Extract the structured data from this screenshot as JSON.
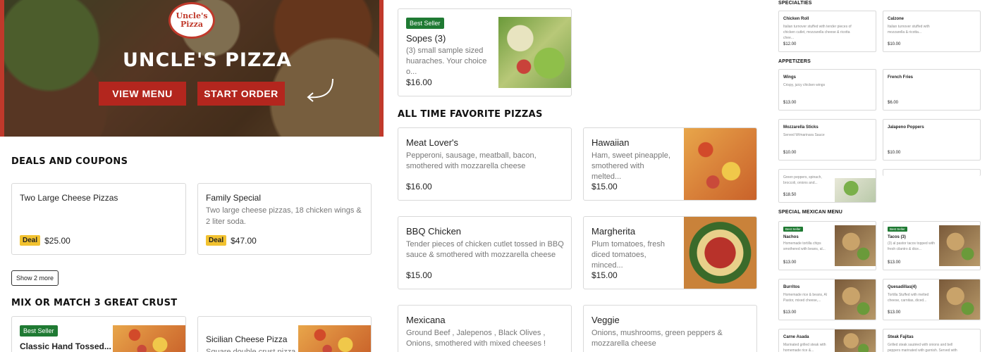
{
  "hero": {
    "logo_line1": "Uncle's",
    "logo_line2": "Pizza",
    "title": "UNCLE'S PIZZA",
    "view_menu": "VIEW MENU",
    "start_order": "START ORDER"
  },
  "deals": {
    "heading": "DEALS AND COUPONS",
    "items": [
      {
        "title": "Two Large Cheese Pizzas",
        "desc": "",
        "badge": "Deal",
        "price": "$25.00"
      },
      {
        "title": "Family Special",
        "desc": "Two large cheese pizzas, 18 chicken wings & 2 liter soda.",
        "badge": "Deal",
        "price": "$47.00"
      }
    ],
    "show_more": "Show 2 more"
  },
  "mix": {
    "heading": "MIX OR MATCH 3 GREAT CRUST",
    "items": [
      {
        "badge": "Best Seller",
        "title": "Classic Hand Tossed..."
      },
      {
        "title": "Sicilian Cheese Pizza",
        "desc": "Square double crust pizza"
      }
    ]
  },
  "top_card": {
    "badge": "Best Seller",
    "title": "Sopes (3)",
    "desc": "(3) small sample sized huaraches. Your choice o...",
    "price": "$16.00"
  },
  "favorites": {
    "heading": "ALL TIME FAVORITE PIZZAS",
    "items": [
      {
        "title": "Meat Lover's",
        "desc": "Pepperoni, sausage, meatball, bacon, smothered with mozzarella cheese",
        "price": "$16.00"
      },
      {
        "title": "Hawaiian",
        "desc": "Ham, sweet pineapple, smothered with melted...",
        "price": "$15.00"
      },
      {
        "title": "BBQ Chicken",
        "desc": "Tender pieces of chicken cutlet tossed in BBQ sauce & smothered with mozzarella cheese",
        "price": "$15.00"
      },
      {
        "title": "Margherita",
        "desc": "Plum tomatoes, fresh diced tomatoes, minced...",
        "price": "$15.00"
      },
      {
        "title": "Mexicana",
        "desc": "Ground Beef , Jalepenos , Black Olives , Onions, smothered with mixed cheeses !"
      },
      {
        "title": "Veggie",
        "desc": "Onions, mushrooms, green peppers & mozzarella cheese"
      }
    ]
  },
  "right": {
    "specialties": {
      "heading": "SPECIALTIES",
      "items": [
        {
          "title": "Chicken Roll",
          "desc": "Italian turnover stuffed with tender pieces of chicken cutlet, mozzarella cheese & ricotta chee...",
          "price": "$12.00"
        },
        {
          "title": "Calzone",
          "desc": "Italian turnover stuffed with mozzarella & ricotta...",
          "price": "$10.00"
        }
      ]
    },
    "appetizers": {
      "heading": "APPETIZERS",
      "items": [
        {
          "title": "Wings",
          "desc": "Crispy, juicy chicken wings",
          "price": "$13.00"
        },
        {
          "title": "French Fries",
          "desc": "",
          "price": "$6.00"
        },
        {
          "title": "Mozzarella Sticks",
          "desc": "Served W/marinara Sauce",
          "price": "$10.00"
        },
        {
          "title": "Jalapeno Poppers",
          "desc": "",
          "price": "$10.00"
        },
        {
          "title": "",
          "desc": "Green peppers, spinach, broccoli, onions and...",
          "price": "$18.50"
        }
      ]
    },
    "mexican": {
      "heading": "SPECIAL MEXICAN MENU",
      "items": [
        {
          "badge": "Best Seller",
          "title": "Nachos",
          "desc": "Homemade tortilla chips smothered with beans, al...",
          "price": "$13.00"
        },
        {
          "badge": "Best Seller",
          "title": "Tacos (3)",
          "desc": "(3) al pastor tacos topped with fresh cilantro & dice...",
          "price": "$13.00"
        },
        {
          "title": "Burritos",
          "desc": "Homemade rice & beans, Al Pastor, mixed cheese,...",
          "price": "$13.00"
        },
        {
          "title": "Quesadillas(4)",
          "desc": "Tortilla Stuffed with melted cheese, carnitas, diced...",
          "price": "$13.00"
        },
        {
          "title": "Carne Asada",
          "desc": "Marinated grilled steak with homemade rice &..."
        },
        {
          "title": "Steak Fajitas",
          "desc": "Grilled steak sautéed with onions and bell peppers marinated with garnish. Served with homemade..."
        }
      ]
    }
  }
}
